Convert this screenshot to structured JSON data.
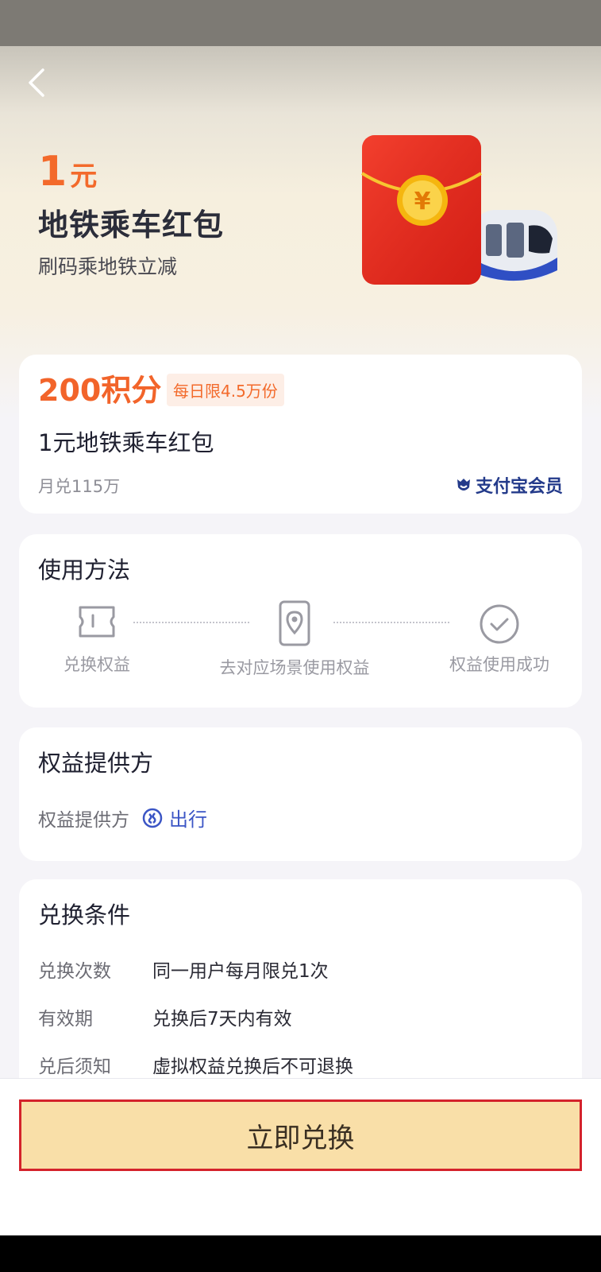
{
  "hero": {
    "amount": "1",
    "unit": "元",
    "title": "地铁乘车红包",
    "subtitle": "刷码乘地铁立减"
  },
  "product": {
    "price": "200积分",
    "daily_limit": "每日限4.5万份",
    "name": "1元地铁乘车红包",
    "monthly": "月兑115万",
    "member_badge": "支付宝会员"
  },
  "usage": {
    "title": "使用方法",
    "steps": [
      {
        "label": "兑换权益",
        "icon": "ticket-icon"
      },
      {
        "label": "去对应场景使用权益",
        "icon": "phone-location-icon"
      },
      {
        "label": "权益使用成功",
        "icon": "check-circle-icon"
      }
    ]
  },
  "provider": {
    "title": "权益提供方",
    "label": "权益提供方",
    "name": "出行"
  },
  "conditions": {
    "title": "兑换条件",
    "rows": [
      {
        "key": "兑换次数",
        "value": "同一用户每月限兑1次"
      },
      {
        "key": "有效期",
        "value": "兑换后7天内有效"
      },
      {
        "key": "兑后须知",
        "value": "虚拟权益兑换后不可退换"
      }
    ]
  },
  "footer": {
    "redeem_label": "立即兑换"
  },
  "colors": {
    "accent_orange": "#f36a2b",
    "brand_blue": "#233a8a",
    "button_bg": "#f9dfa8",
    "highlight_border": "#d4222b"
  }
}
